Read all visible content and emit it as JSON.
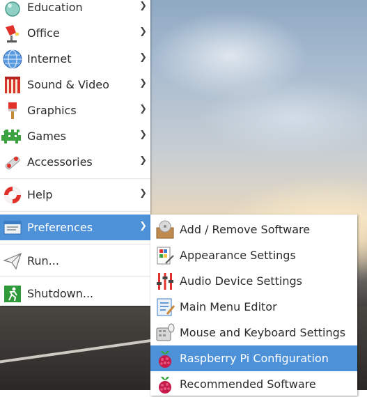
{
  "menu": {
    "items": [
      {
        "label": "Education",
        "icon": "education-icon"
      },
      {
        "label": "Office",
        "icon": "office-icon"
      },
      {
        "label": "Internet",
        "icon": "globe-icon"
      },
      {
        "label": "Sound & Video",
        "icon": "sound-video-icon"
      },
      {
        "label": "Graphics",
        "icon": "paintbrush-icon"
      },
      {
        "label": "Games",
        "icon": "games-icon"
      },
      {
        "label": "Accessories",
        "icon": "accessories-icon"
      },
      {
        "label": "Help",
        "icon": "lifebuoy-icon"
      },
      {
        "label": "Preferences",
        "icon": "preferences-icon"
      },
      {
        "label": "Run...",
        "icon": "paper-plane-icon"
      },
      {
        "label": "Shutdown...",
        "icon": "exit-icon"
      }
    ],
    "selected": "Preferences"
  },
  "submenu": {
    "items": [
      {
        "label": "Add / Remove Software",
        "icon": "package-icon"
      },
      {
        "label": "Appearance Settings",
        "icon": "appearance-icon"
      },
      {
        "label": "Audio Device Settings",
        "icon": "audio-mixer-icon"
      },
      {
        "label": "Main Menu Editor",
        "icon": "menu-editor-icon"
      },
      {
        "label": "Mouse and Keyboard Settings",
        "icon": "keyboard-mouse-icon"
      },
      {
        "label": "Raspberry Pi Configuration",
        "icon": "raspberry-icon"
      },
      {
        "label": "Recommended Software",
        "icon": "raspberry-icon"
      }
    ],
    "selected": "Raspberry Pi Configuration"
  },
  "colors": {
    "highlight": "#4d91d8",
    "menu_bg": "#ffffff"
  }
}
